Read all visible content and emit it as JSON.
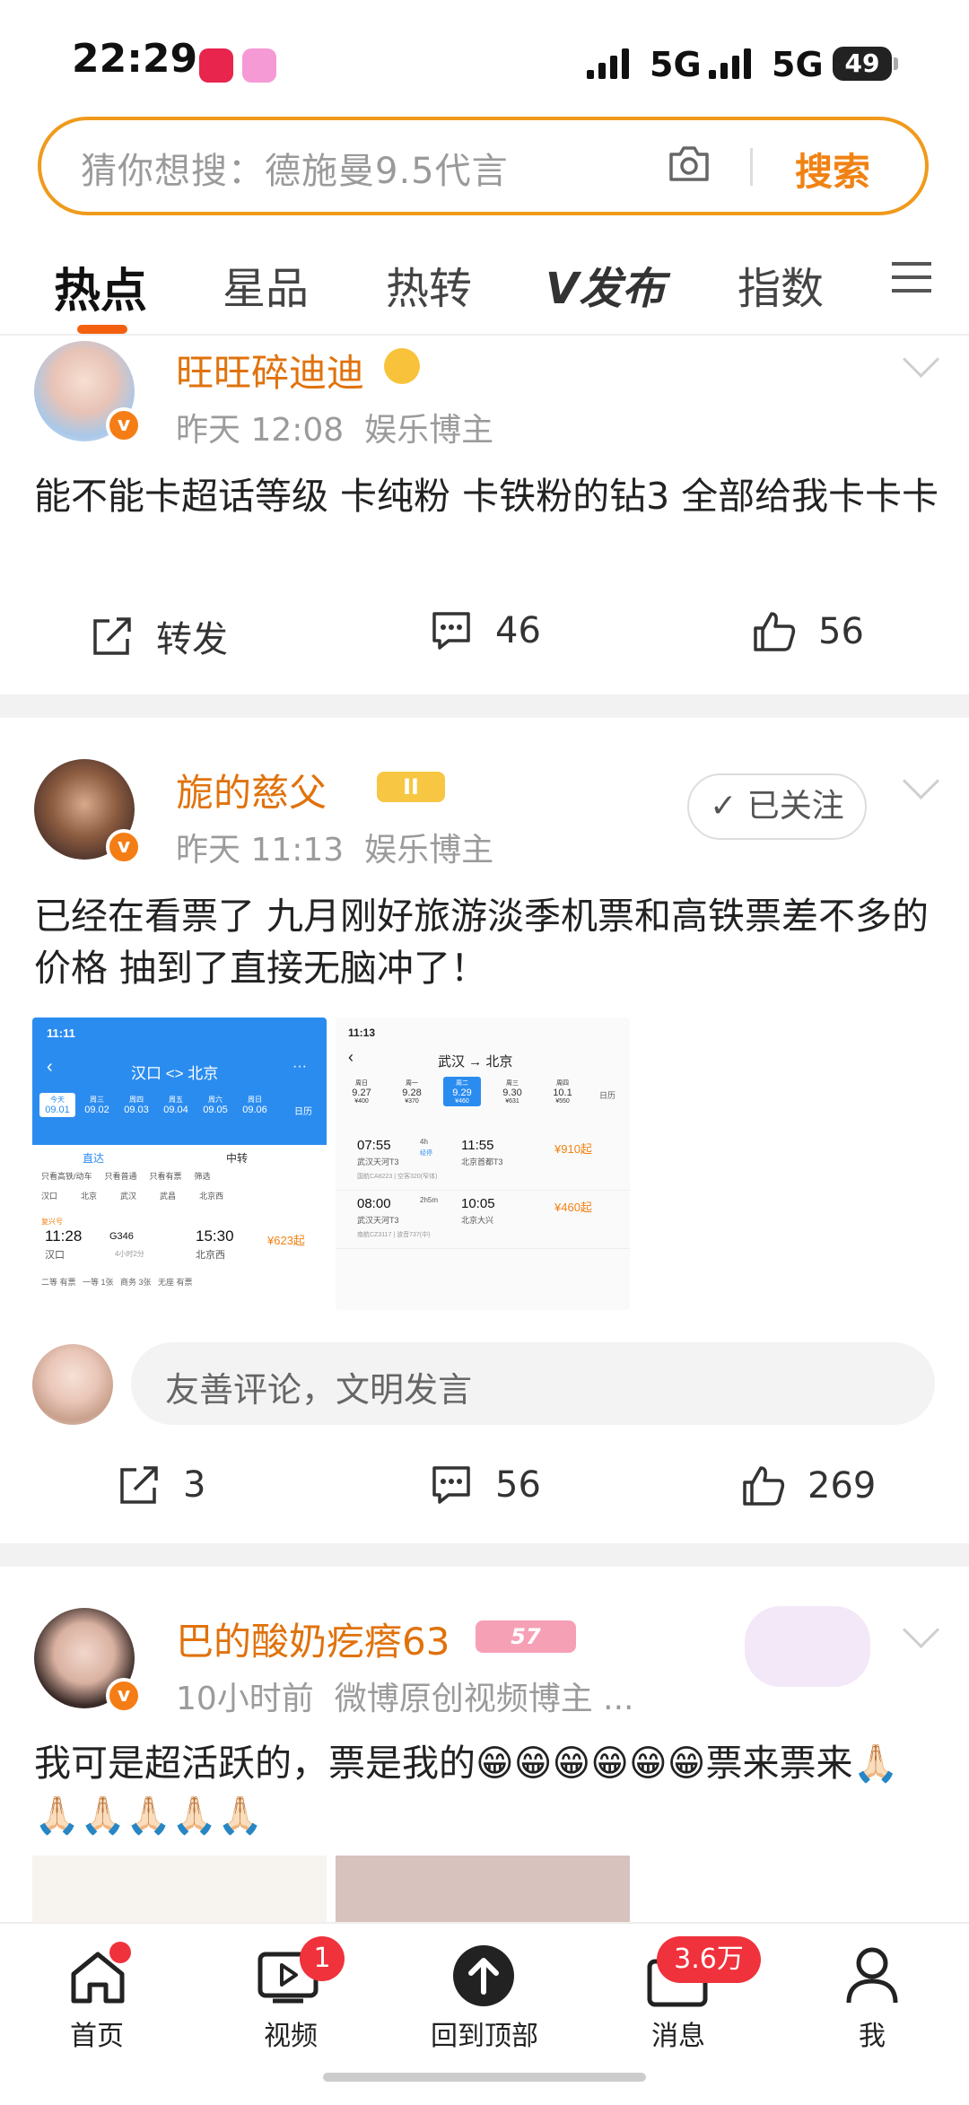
{
  "status": {
    "time": "22:29",
    "net1": "5G",
    "net2": "5G",
    "battery": "49"
  },
  "search": {
    "placeholder": "猜你想搜：德施曼9.5代言",
    "button": "搜索"
  },
  "tabs": [
    "热点",
    "星品",
    "热转",
    "发布",
    "指数"
  ],
  "posts": [
    {
      "user": "旺旺碎迪迪",
      "time": "昨天 12:08",
      "source": "娱乐博主",
      "text": "能不能卡超话等级 卡纯粉 卡铁粉的钻3 全部给我卡卡卡",
      "repost": "转发",
      "comments": "46",
      "likes": "56"
    },
    {
      "user": "旎的慈父",
      "time": "昨天 11:13",
      "source": "娱乐博主",
      "follow": "已关注",
      "level": "II",
      "text": "已经在看票了 九月刚好旅游淡季机票和高铁票差不多的价格 抽到了直接无脑冲了！",
      "comment_placeholder": "友善评论，文明发言",
      "reposts": "3",
      "comments": "56",
      "likes": "269"
    },
    {
      "user": "巴的酸奶疙瘩63",
      "time": "10小时前",
      "source": "微博原创视频博主 ...",
      "level": "57",
      "text": "我可是超活跃的，票是我的😁😁😁😁😁😁票来票来🙏🏻🙏🏻🙏🏻🙏🏻🙏🏻🙏🏻"
    }
  ],
  "train_shot": {
    "time": "11:11",
    "route": "汉口 <> 北京",
    "dates": [
      {
        "w": "今天",
        "d": "09.01"
      },
      {
        "w": "周三",
        "d": "09.02"
      },
      {
        "w": "周四",
        "d": "09.03"
      },
      {
        "w": "周五",
        "d": "09.04"
      },
      {
        "w": "周六",
        "d": "09.05"
      },
      {
        "w": "周日",
        "d": "09.06"
      }
    ],
    "calendar": "日历",
    "tab_direct": "直达",
    "tab_transfer": "中转",
    "filters": [
      "只看高铁/动车",
      "只看普通",
      "只看有票",
      "筛选"
    ],
    "stations": [
      "汉口",
      "北京",
      "武汉",
      "武昌",
      "北京西"
    ],
    "train": "G346",
    "dep": "11:28",
    "arr": "15:30",
    "from": "汉口",
    "to": "北京西",
    "duration": "4小时2分",
    "price": "¥623起",
    "tag": "复兴号",
    "seats": "二等 有票   一等 1张   商务 3张   无座 有票"
  },
  "flight_shot": {
    "time": "11:13",
    "route": "武汉 → 北京",
    "dates": [
      {
        "w": "周日",
        "d": "9.27",
        "p": "¥400"
      },
      {
        "w": "周一",
        "d": "9.28",
        "p": "¥370"
      },
      {
        "w": "周二",
        "d": "9.29",
        "p": "¥460"
      },
      {
        "w": "周三",
        "d": "9.30",
        "p": "¥631"
      },
      {
        "w": "周四",
        "d": "10.1",
        "p": "¥550"
      }
    ],
    "calendar": "日历",
    "flights": [
      {
        "dep": "07:55",
        "arr": "11:55",
        "from": "武汉天河T3",
        "to": "北京首都T3",
        "dur": "4h",
        "via": "经停",
        "price": "¥910起",
        "no": "国航CA8223 | 空客320(窄体)"
      },
      {
        "dep": "08:00",
        "arr": "10:05",
        "from": "武汉天河T3",
        "to": "北京大兴",
        "dur": "2h5m",
        "via": "",
        "price": "¥460起",
        "no": "南航CZ3117 | 波音737(中)"
      }
    ]
  },
  "nav": [
    {
      "label": "首页"
    },
    {
      "label": "视频",
      "badge": "1"
    },
    {
      "label": "回到顶部"
    },
    {
      "label": "消息",
      "badge": "3.6万"
    },
    {
      "label": "我"
    }
  ],
  "colors": {
    "accent": "#f08213",
    "username": "#e0720c",
    "badge": "#f0323c",
    "train_blue": "#2b8cf0"
  }
}
